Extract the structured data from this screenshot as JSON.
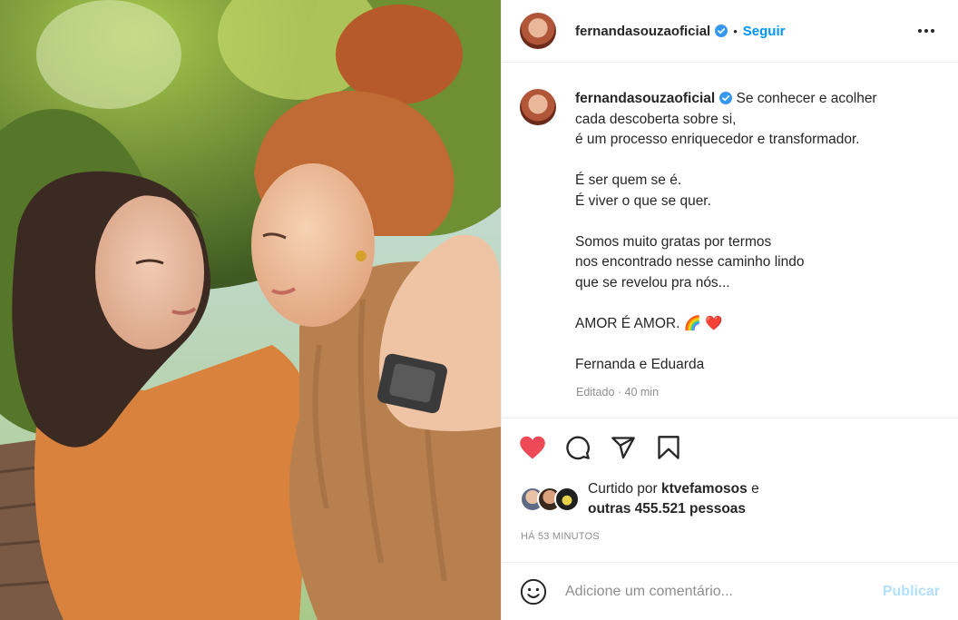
{
  "post": {
    "username": "fernandasouzaoficial",
    "verified": true,
    "follow_label": "Seguir",
    "separator": "•",
    "caption_lines": [
      "Se conhecer e acolher",
      "cada descoberta sobre si,",
      "é um processo enriquecedor e transformador.",
      "",
      "É ser quem se é.",
      "É viver o que se quer.",
      "",
      "Somos muito gratas por termos",
      "nos encontrado nesse caminho lindo",
      "que se revelou pra nós...",
      "",
      "AMOR É AMOR. 🌈 ❤️",
      "",
      "Fernanda e Eduarda"
    ],
    "edited_label": "Editado · 40 min",
    "liked": true,
    "likes_prefix": "Curtido por",
    "likes_user": "ktvefamosos",
    "likes_conj": "e",
    "likes_others": "outras 455.521 pessoas",
    "timestamp": "HÁ 53 MINUTOS",
    "comment_placeholder": "Adicione um comentário...",
    "publish_label": "Publicar"
  },
  "icons": {
    "like": "heart-icon",
    "comment": "comment-icon",
    "share": "paper-plane-icon",
    "save": "bookmark-icon",
    "emoji": "emoji-icon",
    "more": "more-options-icon"
  },
  "colors": {
    "accent": "#0095f6",
    "like_red": "#ed4956",
    "publish_disabled": "#b2dffc",
    "muted": "#8e8e8e",
    "text": "#262626"
  }
}
